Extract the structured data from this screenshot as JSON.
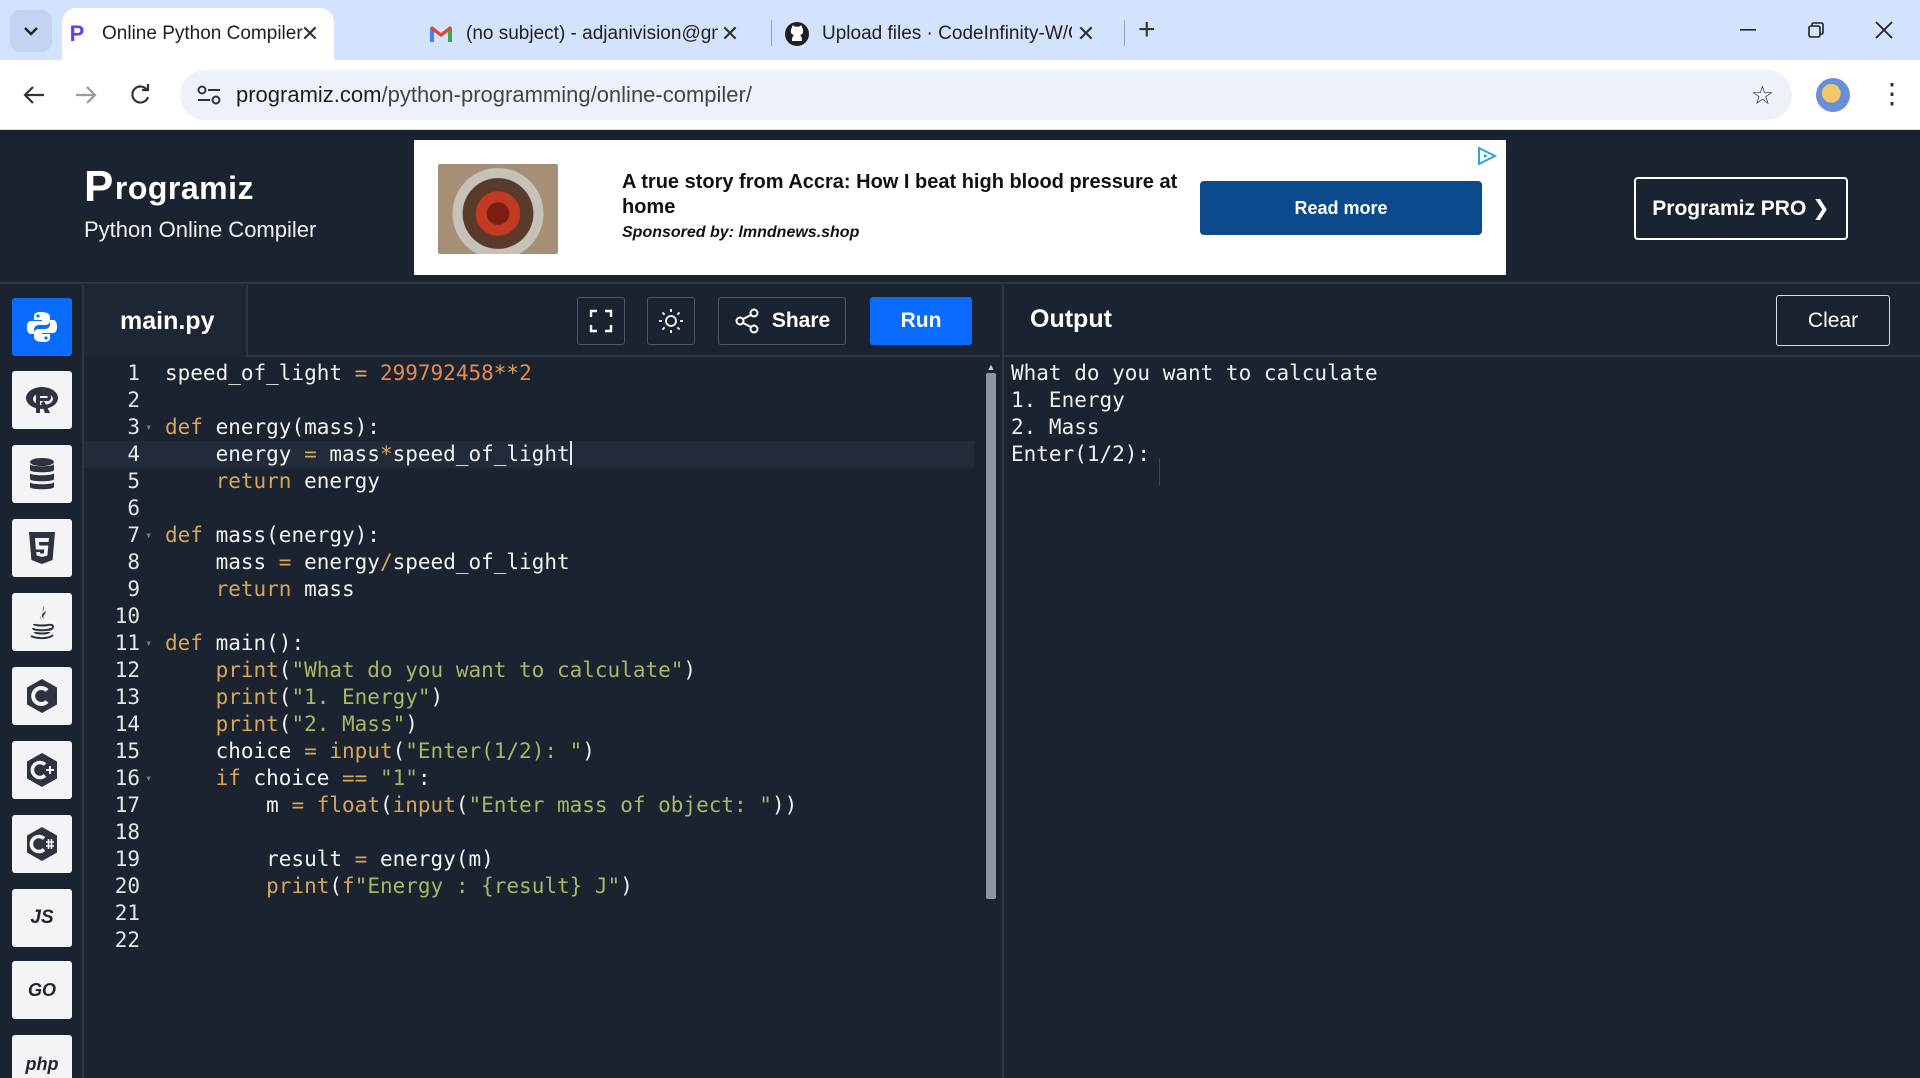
{
  "browser": {
    "tabs": [
      {
        "favicon": "programiz-icon",
        "title": "Online Python Compiler (Interpreter)",
        "active": true
      },
      {
        "favicon": "gmail-icon",
        "title": "(no subject) - adjanivision@gmail.com",
        "active": false
      },
      {
        "favicon": "github-icon",
        "title": "Upload files · CodeInfinity-W/GitHub",
        "active": false
      }
    ],
    "new_tab": "+",
    "address": {
      "host": "programiz.com",
      "path": "/python-programming/online-compiler/"
    }
  },
  "header": {
    "brand": "rogramiz",
    "brand_initial": "P",
    "subtitle": "Python Online Compiler",
    "pro_button": "Programiz PRO ❯"
  },
  "ad": {
    "headline": "A true story from Accra: How I beat high blood pressure at home",
    "sponsor": "Sponsored by: lmndnews.shop",
    "cta": "Read more"
  },
  "sidebar": {
    "languages": [
      {
        "name": "python-icon",
        "label": "",
        "active": true
      },
      {
        "name": "r-icon",
        "label": "R"
      },
      {
        "name": "sql-icon",
        "label": ""
      },
      {
        "name": "html5-icon",
        "label": "5"
      },
      {
        "name": "java-icon",
        "label": ""
      },
      {
        "name": "c-icon",
        "label": "C"
      },
      {
        "name": "cpp-icon",
        "label": "C"
      },
      {
        "name": "csharp-icon",
        "label": "C"
      },
      {
        "name": "javascript-icon",
        "label": "JS"
      },
      {
        "name": "go-icon",
        "label": "GO"
      },
      {
        "name": "php-icon",
        "label": "php"
      }
    ]
  },
  "editor": {
    "filename": "main.py",
    "share_label": "Share",
    "run_label": "Run",
    "current_line": 4,
    "lines": [
      {
        "n": "1",
        "text": "speed_of_light = 299792458**2"
      },
      {
        "n": "2",
        "text": ""
      },
      {
        "n": "3",
        "text": "def energy(mass):"
      },
      {
        "n": "4",
        "text": "    energy = mass*speed_of_light"
      },
      {
        "n": "5",
        "text": "    return energy"
      },
      {
        "n": "6",
        "text": ""
      },
      {
        "n": "7",
        "text": "def mass(energy):"
      },
      {
        "n": "8",
        "text": "    mass = energy/speed_of_light"
      },
      {
        "n": "9",
        "text": "    return mass"
      },
      {
        "n": "10",
        "text": ""
      },
      {
        "n": "11",
        "text": "def main():"
      },
      {
        "n": "12",
        "text": "    print(\"What do you want to calculate\")"
      },
      {
        "n": "13",
        "text": "    print(\"1. Energy\")"
      },
      {
        "n": "14",
        "text": "    print(\"2. Mass\")"
      },
      {
        "n": "15",
        "text": "    choice = input(\"Enter(1/2): \")"
      },
      {
        "n": "16",
        "text": "    if choice == \"1\":"
      },
      {
        "n": "17",
        "text": "        m = float(input(\"Enter mass of object: \"))"
      },
      {
        "n": "18",
        "text": ""
      },
      {
        "n": "19",
        "text": "        result = energy(m)"
      },
      {
        "n": "20",
        "text": "        print(f\"Energy : {result} J\")"
      },
      {
        "n": "21",
        "text": ""
      },
      {
        "n": "22",
        "text": ""
      }
    ],
    "foldable_lines": [
      "3",
      "7",
      "11",
      "16"
    ]
  },
  "output": {
    "title": "Output",
    "clear_label": "Clear",
    "lines": [
      "What do you want to calculate",
      "1. Energy",
      "2. Mass",
      "Enter(1/2): "
    ]
  },
  "colors": {
    "accent": "#0a6bff",
    "background": "#1b2330",
    "keyword": "#d8a657",
    "string": "#a9b665",
    "number": "#e78a4e",
    "ad_button": "#0b4a8c"
  }
}
